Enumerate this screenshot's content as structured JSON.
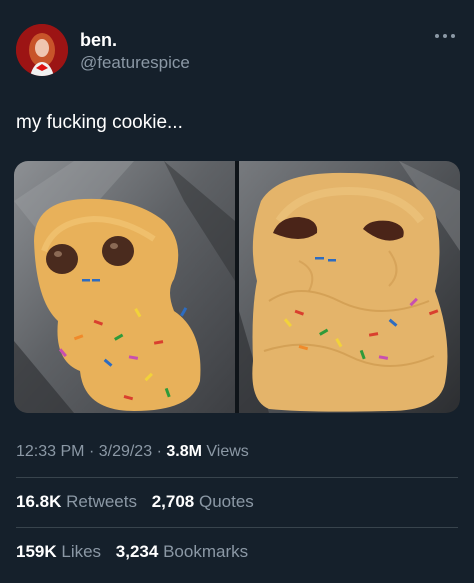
{
  "author": {
    "name": "ben.",
    "handle": "@featurespice"
  },
  "tweet": {
    "text": "my fucking cookie..."
  },
  "media": {
    "photos": [
      {
        "subject": "cookie dough shaped like a figure"
      },
      {
        "subject": "baked cookie shaped like a figure"
      }
    ]
  },
  "meta": {
    "time": "12:33 PM",
    "separator": "·",
    "date": "3/29/23",
    "views_count": "3.8M",
    "views_label": "Views"
  },
  "stats": {
    "retweets_count": "16.8K",
    "retweets_label": "Retweets",
    "quotes_count": "2,708",
    "quotes_label": "Quotes",
    "likes_count": "159K",
    "likes_label": "Likes",
    "bookmarks_count": "3,234",
    "bookmarks_label": "Bookmarks"
  },
  "colors": {
    "background": "#15202b",
    "secondary_text": "#8b98a5",
    "divider": "#38444d",
    "primary_text": "#ffffff"
  },
  "icons": {
    "more": "more-horizontal-icon"
  }
}
